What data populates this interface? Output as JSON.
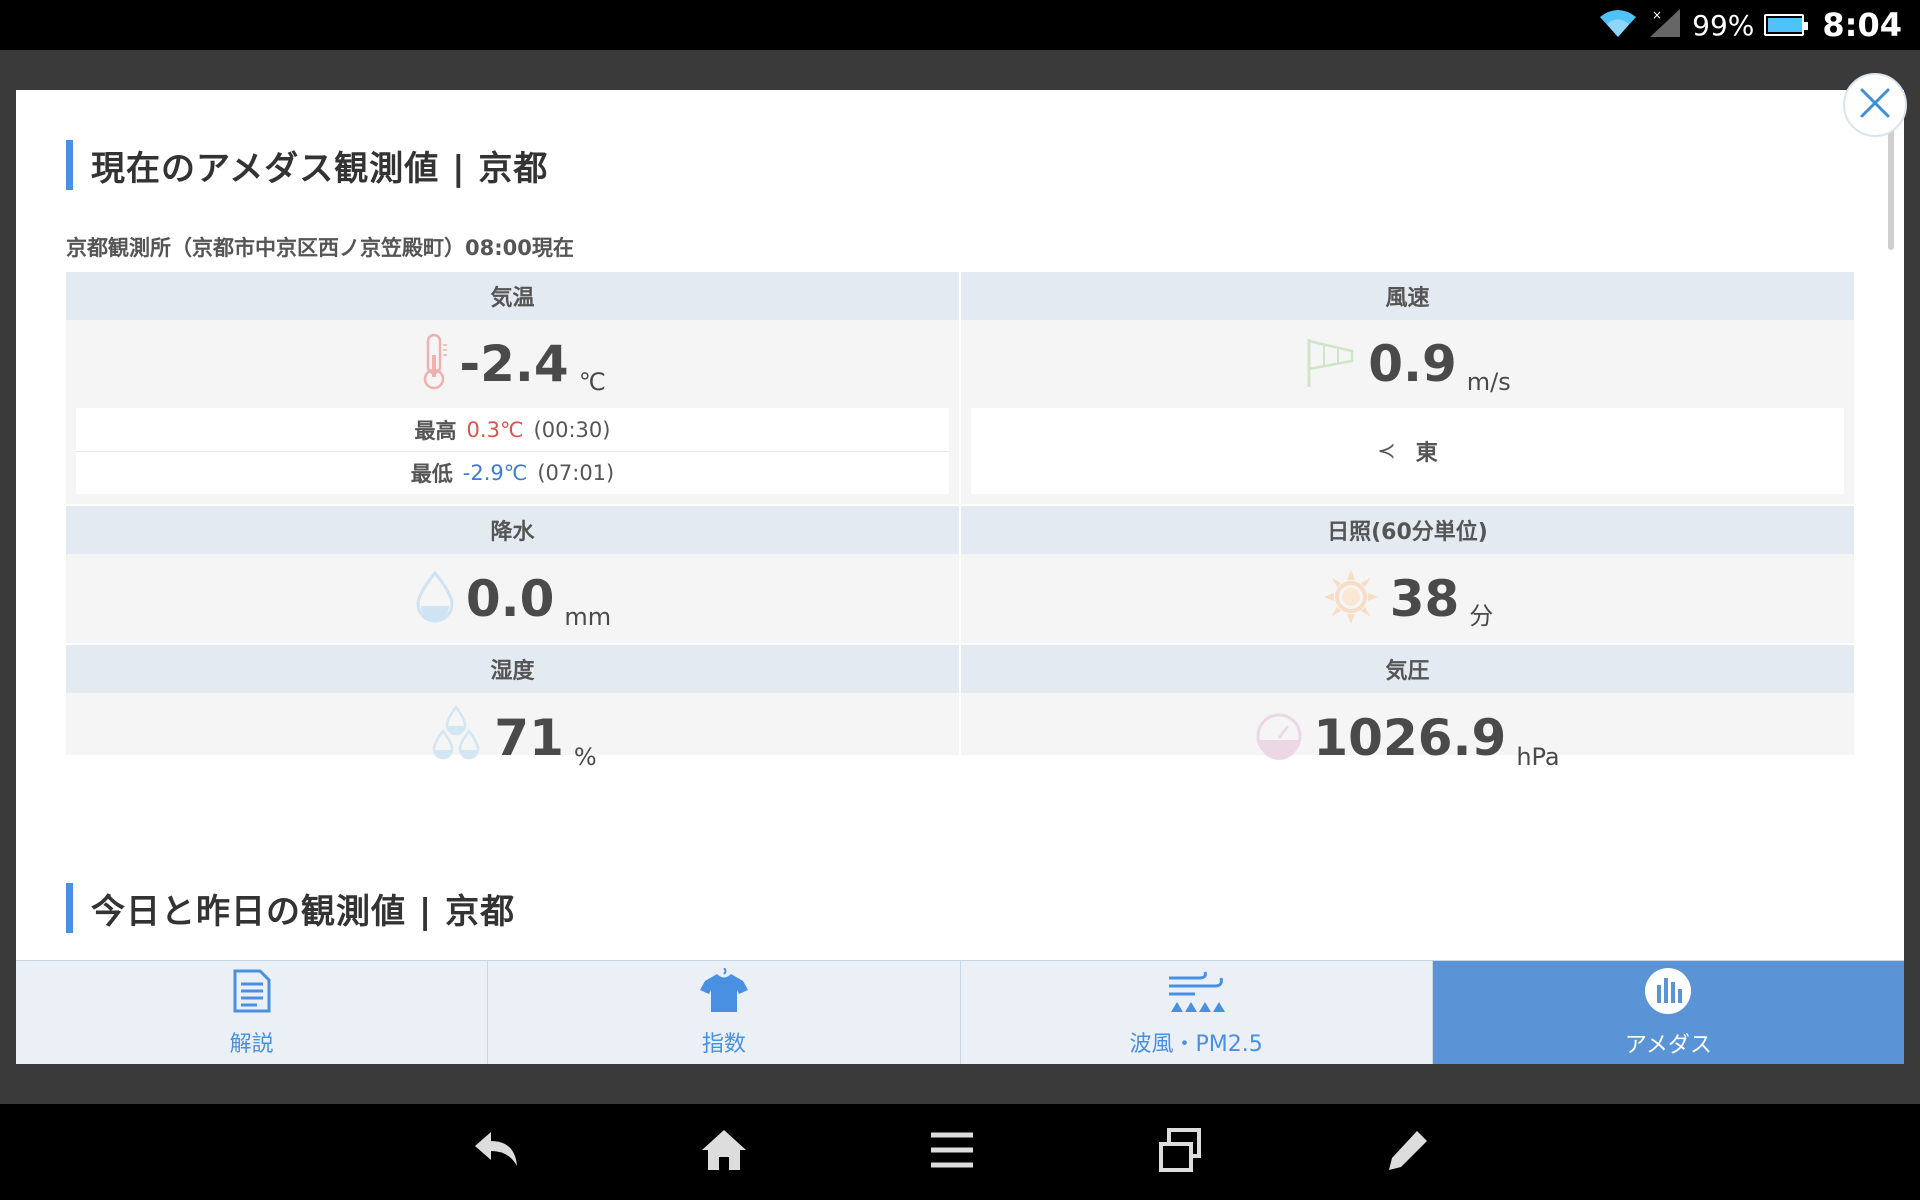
{
  "status_bar": {
    "battery_pct": "99%",
    "battery_level": 0.99,
    "clock": "8:04"
  },
  "section1": {
    "title": "現在のアメダス観測値 | 京都",
    "station": "京都観測所（京都市中京区西ノ京笠殿町）08:00現在"
  },
  "temperature": {
    "label": "気温",
    "value": "-2.4",
    "unit": "℃",
    "max_label": "最高",
    "max_value": "0.3℃",
    "max_time": "(00:30)",
    "min_label": "最低",
    "min_value": "-2.9℃",
    "min_time": "(07:01)",
    "icon": "thermometer-icon"
  },
  "wind": {
    "label": "風速",
    "value": "0.9",
    "unit": "m/s",
    "direction_arrow": "≺",
    "direction": "東",
    "icon": "windsock-icon"
  },
  "precipitation": {
    "label": "降水",
    "value": "0.0",
    "unit": "mm",
    "icon": "raindrop-icon"
  },
  "sunshine": {
    "label": "日照(60分単位)",
    "value": "38",
    "unit": "分",
    "icon": "sun-icon"
  },
  "humidity": {
    "label": "湿度",
    "value": "71",
    "unit": "%",
    "icon": "humidity-drops-icon"
  },
  "pressure": {
    "label": "気圧",
    "value": "1026.9",
    "unit": "hPa",
    "icon": "barometer-icon"
  },
  "section2": {
    "title": "今日と昨日の観測値 | 京都"
  },
  "tabs": [
    {
      "label": "解説",
      "icon": "document-icon",
      "active": false
    },
    {
      "label": "指数",
      "icon": "shirt-icon",
      "active": false
    },
    {
      "label": "波風・PM2.5",
      "icon": "wave-wind-icon",
      "active": false
    },
    {
      "label": "アメダス",
      "icon": "bar-chart-icon",
      "active": true
    }
  ],
  "colors": {
    "accent": "#4a90e2",
    "active_tab": "#5a93d6",
    "max_temp": "#d9534f",
    "min_temp": "#3d7ccf"
  }
}
